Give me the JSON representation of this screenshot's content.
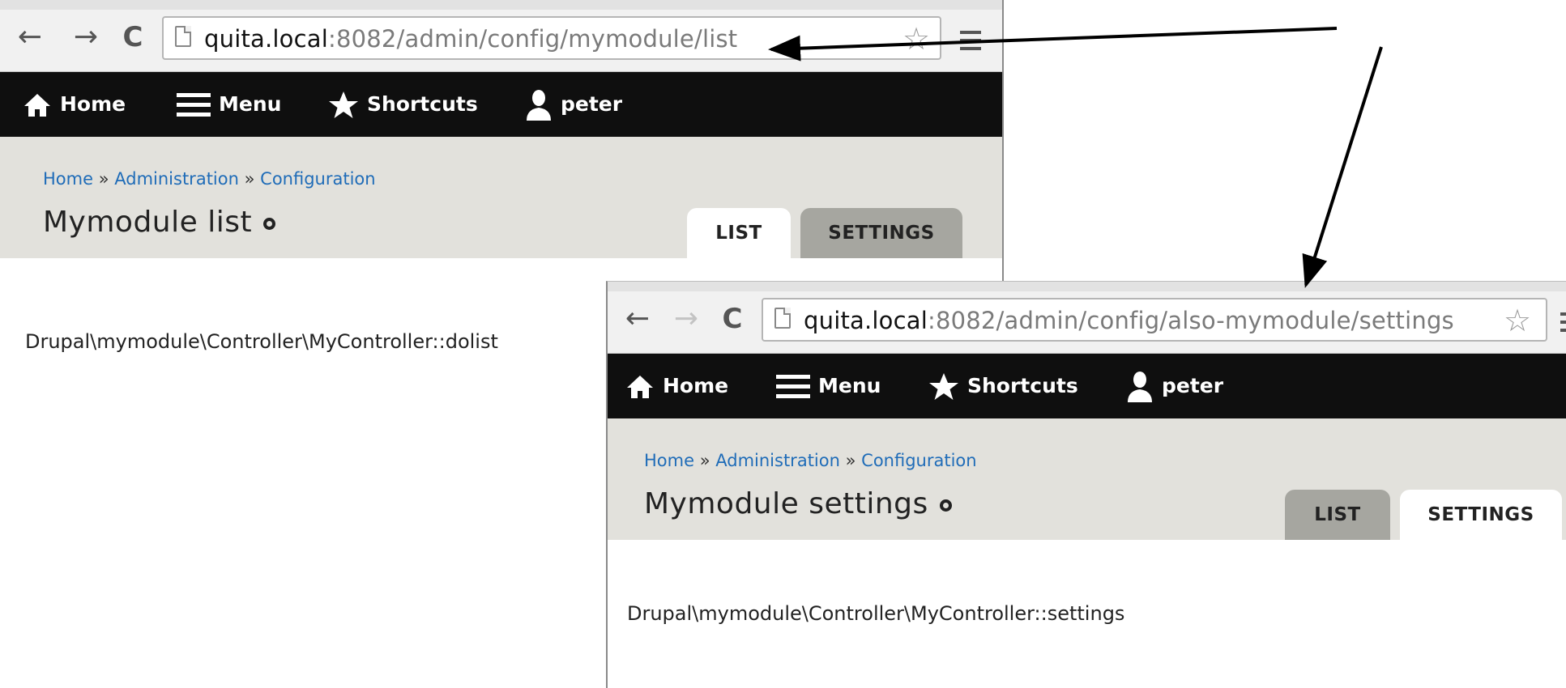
{
  "windows": [
    {
      "url_host": "quita.local",
      "url_path": ":8082/admin/config/mymodule/list",
      "toolbar": {
        "home": "Home",
        "menu": "Menu",
        "shortcuts": "Shortcuts",
        "user": "peter"
      },
      "breadcrumb": [
        "Home",
        "Administration",
        "Configuration"
      ],
      "breadcrumb_separator": "»",
      "page_title": "Mymodule list",
      "tabs": [
        {
          "label": "LIST",
          "active": true
        },
        {
          "label": "SETTINGS",
          "active": false
        }
      ],
      "content": "Drupal\\mymodule\\Controller\\MyController::dolist"
    },
    {
      "url_host": "quita.local",
      "url_path": ":8082/admin/config/also-mymodule/settings",
      "toolbar": {
        "home": "Home",
        "menu": "Menu",
        "shortcuts": "Shortcuts",
        "user": "peter"
      },
      "breadcrumb": [
        "Home",
        "Administration",
        "Configuration"
      ],
      "breadcrumb_separator": "»",
      "page_title": "Mymodule settings",
      "tabs": [
        {
          "label": "LIST",
          "active": false
        },
        {
          "label": "SETTINGS",
          "active": true
        }
      ],
      "content": "Drupal\\mymodule\\Controller\\MyController::settings"
    }
  ],
  "colors": {
    "admin_bar": "#0f0f0f",
    "header_bg": "#e2e1dc",
    "link": "#1f6cb8",
    "tab_inactive": "#a6a6a0"
  },
  "icons": {
    "back": "arrow-left",
    "forward": "arrow-right",
    "reload": "reload",
    "page": "document",
    "bookmark": "star-outline",
    "chrome_menu": "hamburger",
    "home": "house",
    "menu": "hamburger",
    "shortcuts": "star",
    "user": "person"
  }
}
